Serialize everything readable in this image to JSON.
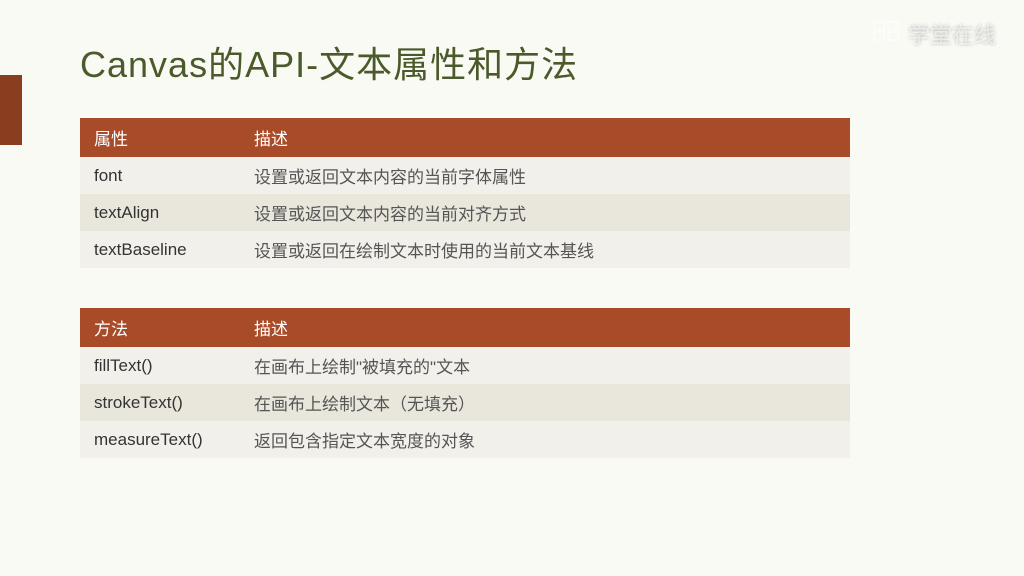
{
  "watermark": {
    "text": "学堂在线"
  },
  "title": "Canvas的API-文本属性和方法",
  "table1": {
    "headers": {
      "name": "属性",
      "desc": "描述"
    },
    "rows": [
      {
        "name": "font",
        "desc": "设置或返回文本内容的当前字体属性"
      },
      {
        "name": "textAlign",
        "desc": "设置或返回文本内容的当前对齐方式"
      },
      {
        "name": "textBaseline",
        "desc": "设置或返回在绘制文本时使用的当前文本基线"
      }
    ]
  },
  "table2": {
    "headers": {
      "name": "方法",
      "desc": "描述"
    },
    "rows": [
      {
        "name": "fillText()",
        "desc": "在画布上绘制\"被填充的\"文本"
      },
      {
        "name": "strokeText()",
        "desc": "在画布上绘制文本（无填充）"
      },
      {
        "name": "measureText()",
        "desc": "返回包含指定文本宽度的对象"
      }
    ]
  }
}
